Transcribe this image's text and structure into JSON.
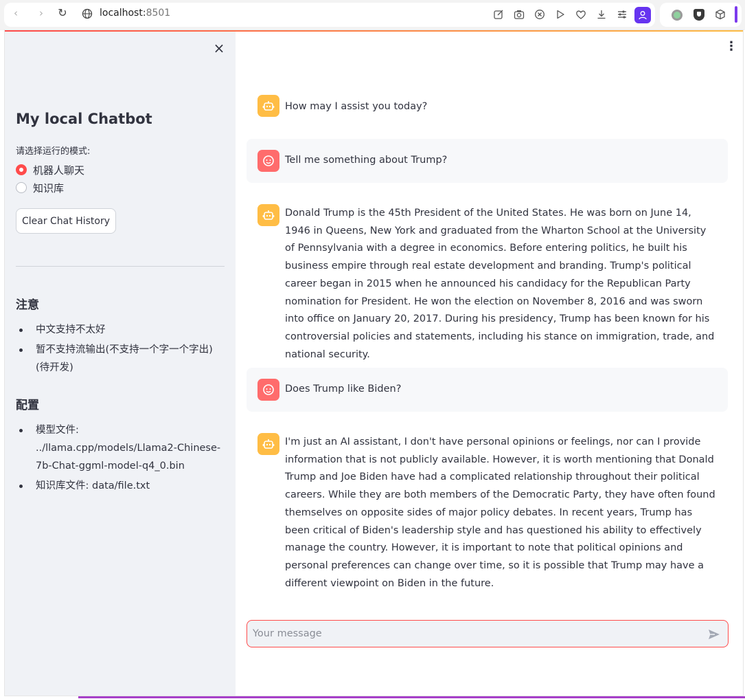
{
  "browser": {
    "url_host": "localhost:",
    "url_port": "8501"
  },
  "sidebar": {
    "close_icon": "×",
    "title": "My local Chatbot",
    "mode_label": "请选择运行的模式:",
    "modes": [
      {
        "label": "机器人聊天",
        "selected": true
      },
      {
        "label": "知识库",
        "selected": false
      }
    ],
    "clear_button": "Clear Chat History",
    "notes_heading": "注意",
    "notes": [
      "中文支持不太好",
      "暂不支持流输出(不支持一个字一个字出)(待开发)"
    ],
    "config_heading": "配置",
    "config": [
      "模型文件: ../llama.cpp/models/Llama2-Chinese-7b-Chat-ggml-model-q4_0.bin",
      "知识库文件: data/file.txt"
    ]
  },
  "main": {
    "menu_icon": "⋮",
    "messages": [
      {
        "role": "assistant",
        "text": "How may I assist you today?"
      },
      {
        "role": "user",
        "text": "Tell me something about Trump?"
      },
      {
        "role": "assistant",
        "text": "Donald Trump is the 45th President of the United States. He was born on June 14, 1946 in Queens, New York and graduated from the Wharton School at the University of Pennsylvania with a degree in economics. Before entering politics, he built his business empire through real estate development and branding. Trump's political career began in 2015 when he announced his candidacy for the Republican Party nomination for President. He won the election on November 8, 2016 and was sworn into office on January 20, 2017. During his presidency, Trump has been known for his controversial policies and statements, including his stance on immigration, trade, and national security."
      },
      {
        "role": "user",
        "text": "Does Trump like Biden?"
      },
      {
        "role": "assistant",
        "text": "I'm just an AI assistant, I don't have personal opinions or feelings, nor can I provide information that is not publicly available. However, it is worth mentioning that Donald Trump and Joe Biden have had a complicated relationship throughout their political careers. While they are both members of the Democratic Party, they have often found themselves on opposite sides of major policy debates. In recent years, Trump has been critical of Biden's leadership style and has questioned his ability to effectively manage the country. However, it is important to note that political opinions and personal preferences can change over time, so it is possible that Trump may have a different viewpoint on Biden in the future."
      }
    ],
    "input_placeholder": "Your message"
  },
  "colors": {
    "primary": "#ff4b4b",
    "bot_avatar": "#ffbd45",
    "user_avatar": "#ff6c6c",
    "sidebar_bg": "#f0f2f6",
    "text": "#31333f"
  },
  "icons": {
    "back": "back-arrow-icon",
    "forward": "forward-arrow-icon",
    "reload": "reload-icon",
    "site": "globe-icon",
    "close": "close-icon",
    "menu": "more-vertical-icon",
    "bot_avatar": "robot-icon",
    "user_avatar": "smiley-face-icon",
    "send": "send-icon"
  }
}
